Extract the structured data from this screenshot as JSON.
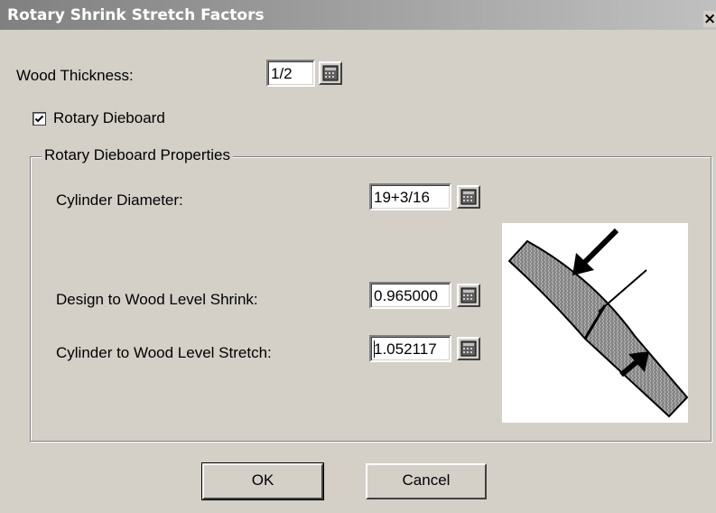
{
  "window": {
    "title": "Rotary Shrink Stretch Factors",
    "close_glyph": "×"
  },
  "wood_thickness": {
    "label": "Wood Thickness:",
    "value": "1/2",
    "button_icon": "calculator-icon"
  },
  "rotary_dieboard": {
    "label": "Rotary Dieboard",
    "checked": true
  },
  "group": {
    "title": "Rotary Dieboard Properties",
    "cylinder_diameter": {
      "label": "Cylinder Diameter:",
      "value": "19+3/16"
    },
    "shrink": {
      "label": "Design to Wood Level Shrink:",
      "value": "0.965000"
    },
    "stretch": {
      "label": "Cylinder to Wood Level Stretch:",
      "value": "1.052117"
    }
  },
  "diagram": {
    "name": "rotary-die-curvature-diagram"
  },
  "buttons": {
    "ok": "OK",
    "cancel": "Cancel"
  },
  "colors": {
    "face": "#d4d0c8",
    "title_start": "#808080",
    "title_end": "#c0c0c0"
  }
}
